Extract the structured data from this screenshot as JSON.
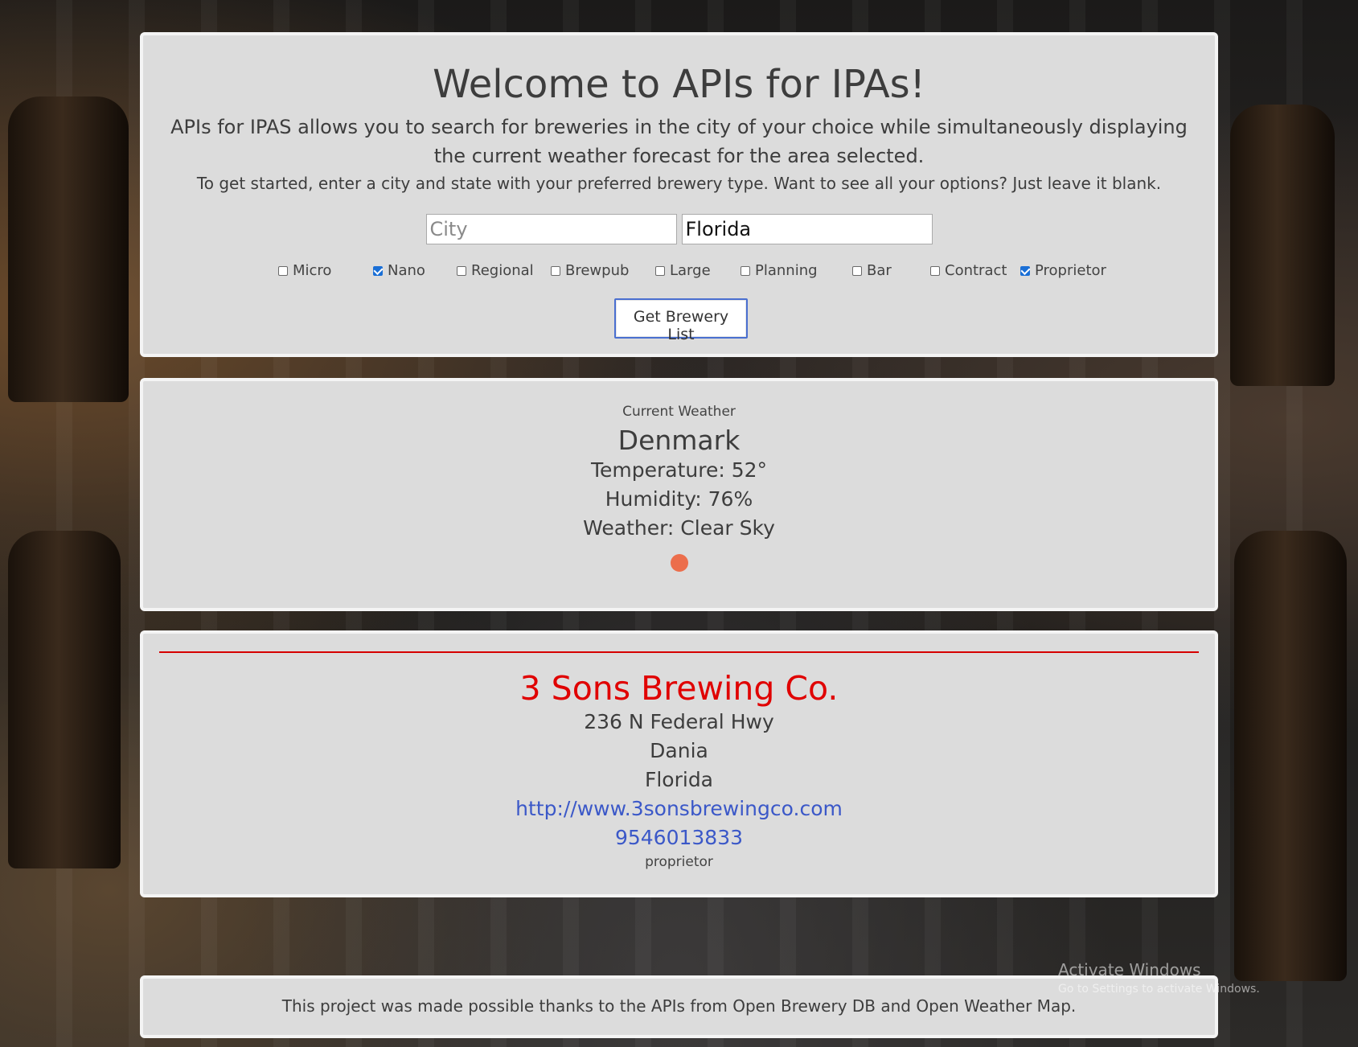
{
  "header": {
    "title": "Welcome to APIs for IPAs!",
    "intro": "APIs for IPAS allows you to search for breweries in the city of your choice while simultaneously displaying the current weather forecast for the area selected.",
    "instructions": "To get started, enter a city and state with your preferred brewery type. Want to see all your options? Just leave it blank.",
    "city_input": {
      "value": "",
      "placeholder": "City"
    },
    "state_input": {
      "value": "Florida",
      "placeholder": ""
    },
    "brewery_types": [
      {
        "label": "Micro",
        "checked": false
      },
      {
        "label": "Nano",
        "checked": true
      },
      {
        "label": "Regional",
        "checked": false
      },
      {
        "label": "Brewpub",
        "checked": false
      },
      {
        "label": "Large",
        "checked": false
      },
      {
        "label": "Planning",
        "checked": false
      },
      {
        "label": "Bar",
        "checked": false
      },
      {
        "label": "Contract",
        "checked": false
      },
      {
        "label": "Proprietor",
        "checked": true
      }
    ],
    "submit_label": "Get Brewery List"
  },
  "weather": {
    "caption": "Current Weather",
    "city": "Denmark",
    "temperature": "Temperature: 52°",
    "humidity": "Humidity: 76%",
    "condition": "Weather: Clear Sky",
    "icon": "sun-icon",
    "icon_color": "#ec6e4c"
  },
  "brewery": {
    "name": "3 Sons Brewing Co.",
    "street": "236 N Federal Hwy",
    "city": "Dania",
    "state": "Florida",
    "website": "http://www.3sonsbrewingco.com",
    "phone": "9546013833",
    "type": "proprietor"
  },
  "footer": {
    "text": "This project was made possible thanks to the APIs from Open Brewery DB and Open Weather Map."
  },
  "watermark": {
    "line1": "Activate Windows",
    "line2": "Go to Settings to activate Windows."
  },
  "colors": {
    "panel": "#dcdcdc",
    "brewery_name": "#e00000",
    "link": "#3b58c8",
    "checkbox_checked": "#1a6fd6"
  }
}
